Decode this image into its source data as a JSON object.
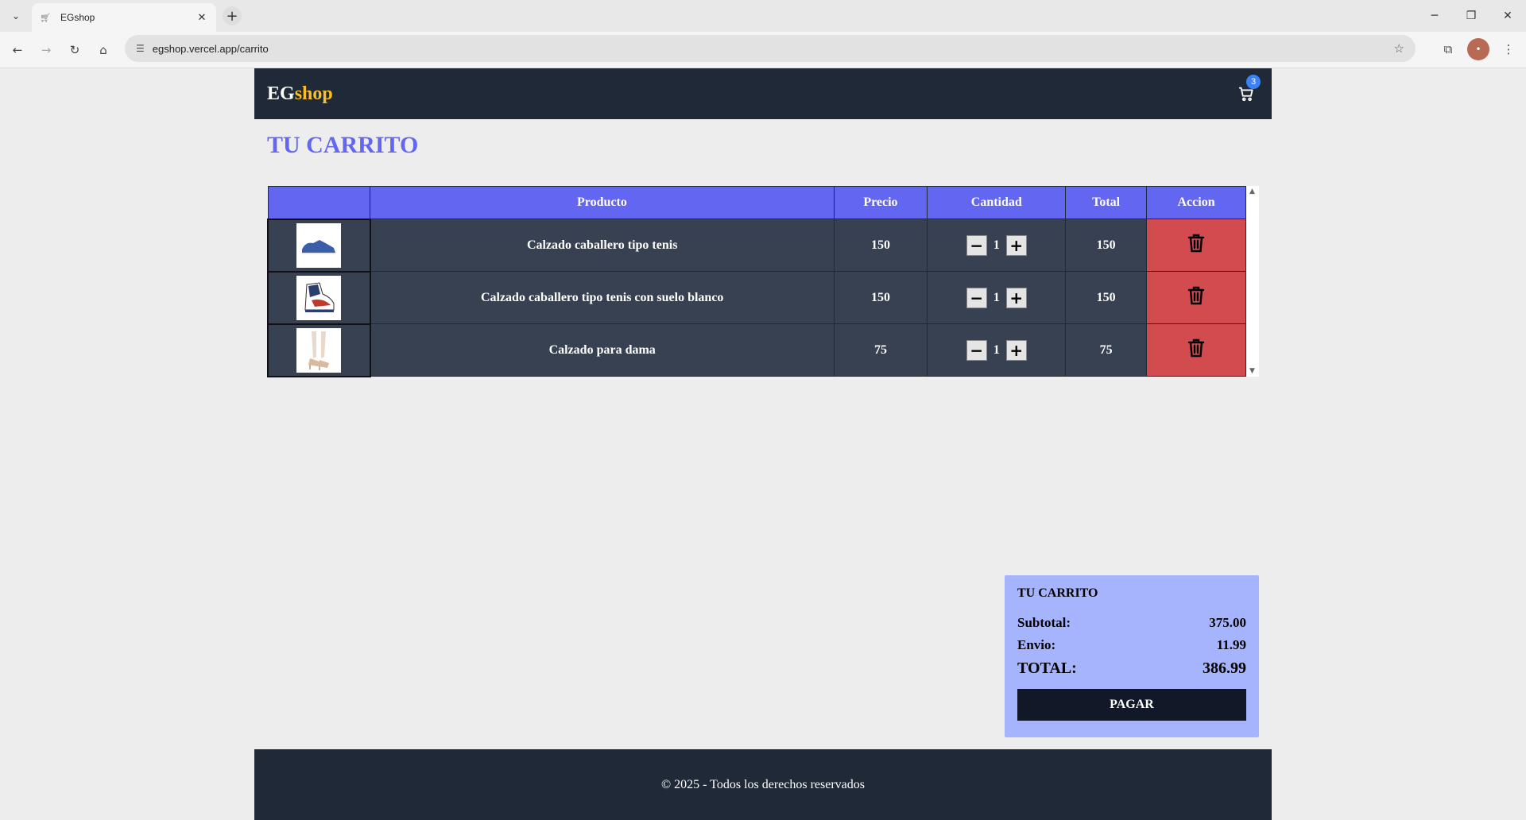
{
  "browser": {
    "tab_title": "EGshop",
    "url": "egshop.vercel.app/carrito",
    "avatar_initial": "•"
  },
  "header": {
    "logo_part1": "EG",
    "logo_part2": "shop",
    "cart_count": "3",
    "accent_color": "#fbbf24"
  },
  "page": {
    "title": "TU CARRITO"
  },
  "table": {
    "headers": [
      "",
      "Producto",
      "Precio",
      "Cantidad",
      "Total",
      "Accion"
    ],
    "rows": [
      {
        "name": "Calzado caballero tipo tenis",
        "price": "150",
        "qty": "1",
        "total": "150"
      },
      {
        "name": "Calzado caballero tipo tenis con suelo blanco",
        "price": "150",
        "qty": "1",
        "total": "150"
      },
      {
        "name": "Calzado para dama",
        "price": "75",
        "qty": "1",
        "total": "75"
      }
    ]
  },
  "summary": {
    "title": "TU CARRITO",
    "subtotal_label": "Subtotal:",
    "subtotal_value": "375.00",
    "shipping_label": "Envio:",
    "shipping_value": "11.99",
    "total_label": "TOTAL:",
    "total_value": "386.99",
    "pay_label": "PAGAR"
  },
  "footer": {
    "text": "© 2025 - Todos los derechos reservados"
  },
  "colors": {
    "header_bg": "#1f2937",
    "primary": "#6366f1",
    "row_bg": "#374151",
    "delete_bg": "#d14b4f",
    "summary_bg": "#a5b4fc"
  }
}
